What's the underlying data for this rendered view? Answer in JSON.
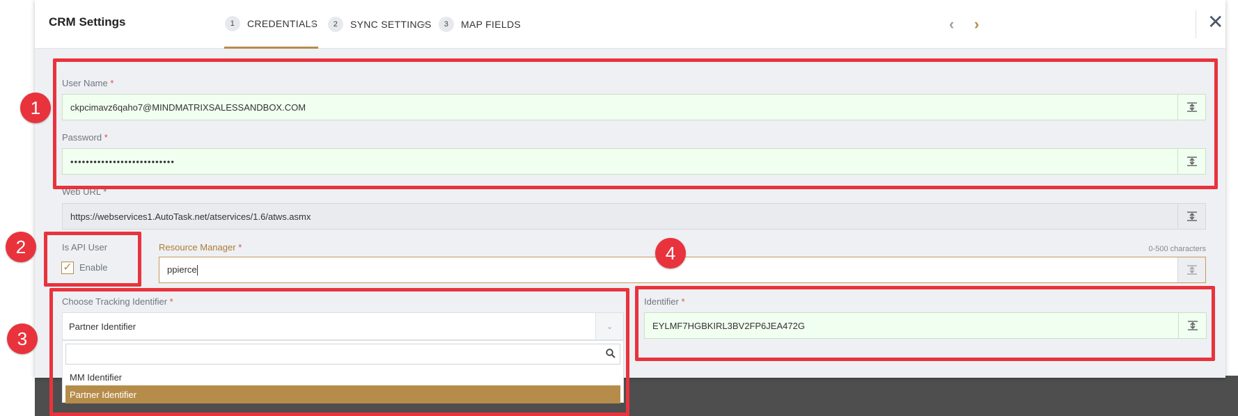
{
  "modal": {
    "title": "CRM Settings",
    "steps": [
      {
        "num": "1",
        "label": "CREDENTIALS",
        "active": true
      },
      {
        "num": "2",
        "label": "SYNC SETTINGS",
        "active": false
      },
      {
        "num": "3",
        "label": "MAP FIELDS",
        "active": false
      }
    ],
    "nav_prev": "‹",
    "nav_next": "›",
    "close": "✕"
  },
  "form": {
    "username": {
      "label": "User Name",
      "required": "*",
      "value": "ckpcimavz6qaho7@MINDMATRIXSALESSANDBOX.COM"
    },
    "password": {
      "label": "Password",
      "required": "*",
      "value": "•••••••••••••••••••••••••••"
    },
    "web_url": {
      "label": "Web URL",
      "required": "*",
      "value": "https://webservices1.AutoTask.net/atservices/1.6/atws.asmx"
    },
    "api_user": {
      "label": "Is API User",
      "checkbox_label": "Enable",
      "checked": true
    },
    "resource_manager": {
      "label": "Resource Manager",
      "required": "*",
      "value": "ppierce",
      "char_hint": "0-500 characters"
    },
    "tracking_identifier": {
      "label": "Choose Tracking Identifier",
      "required": "*",
      "selected": "Partner Identifier",
      "search_placeholder": "",
      "options": [
        "MM Identifier",
        "Partner Identifier"
      ]
    },
    "identifier": {
      "label": "Identifier",
      "required": "*",
      "value": "EYLMF7HGBKIRL3BV2FP6JEA472G"
    }
  },
  "annotations": {
    "badges": [
      "1",
      "2",
      "3",
      "4"
    ]
  },
  "colors": {
    "accent": "#b68c4a",
    "annotation_red": "#e8333d",
    "valid_field_bg": "#f1fff0"
  }
}
